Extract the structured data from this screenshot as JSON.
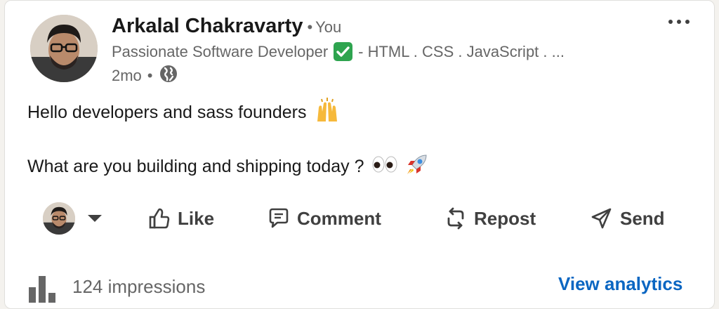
{
  "post": {
    "author": {
      "name": "Arkalal Chakravarty",
      "relation": "You",
      "headline_prefix": "Passionate Software Developer",
      "headline_suffix": "- HTML . CSS . JavaScript . ...",
      "time": "2mo",
      "visibility_icon": "globe-icon"
    },
    "more_label": "…",
    "lines": [
      "Hello developers and sass founders",
      "What are you building and shipping today ?"
    ],
    "emojis": {
      "line1": "raising-hands-icon",
      "line2": [
        "eyes-icon",
        "rocket-icon"
      ]
    }
  },
  "actions": {
    "like": "Like",
    "comment": "Comment",
    "repost": "Repost",
    "send": "Send"
  },
  "stats": {
    "impressions": "124 impressions",
    "analytics_link": "View analytics"
  },
  "colors": {
    "accent": "#0a66c2",
    "check": "#2ea44f"
  }
}
